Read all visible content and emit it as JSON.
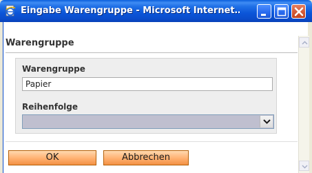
{
  "window": {
    "title": "Eingabe Warengruppe - Microsoft Internet…",
    "icons": {
      "app": "ie-document-icon",
      "minimize": "minimize-icon",
      "maximize": "maximize-icon",
      "close": "close-icon"
    },
    "colors": {
      "titlebar": "#0b55d8",
      "close": "#d45a37"
    }
  },
  "panel": {
    "title": "Warengruppe"
  },
  "form": {
    "warengruppe_label": "Warengruppe",
    "warengruppe_value": "Papier",
    "reihenfolge_label": "Reihenfolge",
    "reihenfolge_value": ""
  },
  "buttons": {
    "ok": "OK",
    "cancel": "Abbrechen",
    "accent": "#f29044"
  }
}
